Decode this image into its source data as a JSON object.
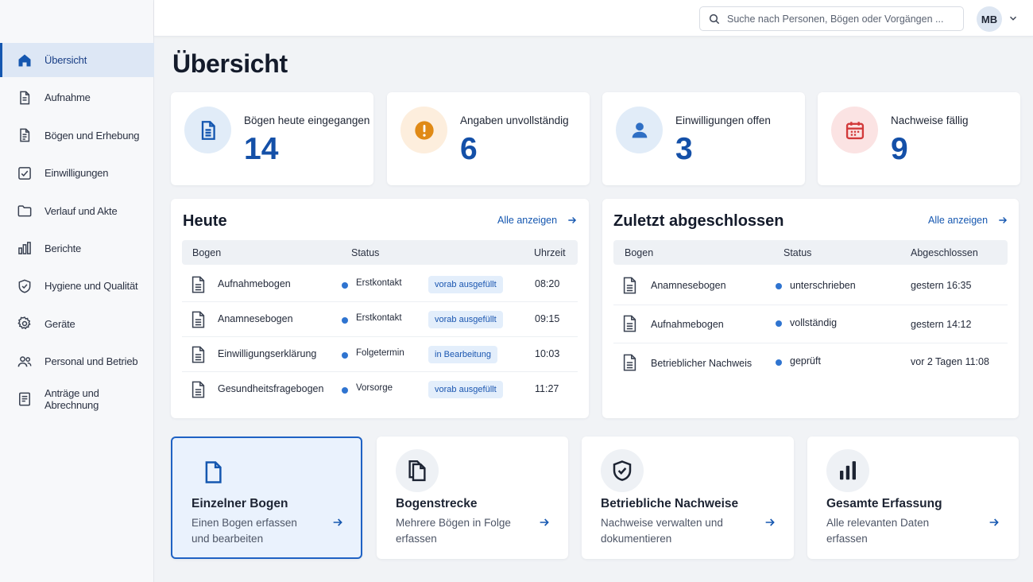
{
  "topbar": {
    "search_placeholder": "Suche nach Personen, Bögen oder Vorgängen ...",
    "avatar_initials": "MB"
  },
  "sidebar": {
    "items": [
      {
        "label": "Übersicht",
        "icon": "home-icon",
        "active": true
      },
      {
        "label": "Aufnahme",
        "icon": "document-icon"
      },
      {
        "label": "Bögen und Erhebung",
        "icon": "form-icon"
      },
      {
        "label": "Einwilligungen",
        "icon": "checkbox-icon"
      },
      {
        "label": "Verlauf und Akte",
        "icon": "folder-icon"
      },
      {
        "label": "Berichte",
        "icon": "bar-chart-icon"
      },
      {
        "label": "Hygiene und Qualität",
        "icon": "shield-icon"
      },
      {
        "label": "Geräte",
        "icon": "gear-icon"
      },
      {
        "label": "Personal und Betrieb",
        "icon": "people-icon"
      },
      {
        "label": "Anträge und Abrechnung",
        "icon": "list-document-icon"
      }
    ]
  },
  "page": {
    "title": "Übersicht"
  },
  "stats": [
    {
      "label": "Bögen heute eingegangen",
      "value": "14",
      "icon": "document-icon",
      "color": "#1557b0",
      "bg": "#e1ecf8"
    },
    {
      "label": "Angaben unvollständig",
      "value": "6",
      "icon": "warning-icon",
      "color": "#e08a16",
      "bg": "#fdeedd"
    },
    {
      "label": "Einwilligungen offen",
      "value": "3",
      "icon": "person-icon",
      "color": "#2f6fc4",
      "bg": "#e1ecf8"
    },
    {
      "label": "Nachweise fällig",
      "value": "9",
      "icon": "calendar-icon",
      "color": "#d2393a",
      "bg": "#fbe3e3"
    }
  ],
  "today": {
    "title": "Heute",
    "show_all": "Alle anzeigen",
    "columns": [
      "Bogen",
      "Status",
      "Uhrzeit"
    ],
    "rows": [
      {
        "bogen": "Aufnahmebogen",
        "status": "Erstkontakt",
        "chip": "vorab ausgefüllt",
        "time": "08:20"
      },
      {
        "bogen": "Anamnesebogen",
        "status": "Erstkontakt",
        "chip": "vorab ausgefüllt",
        "time": "09:15"
      },
      {
        "bogen": "Einwilligungserklärung",
        "status": "Folgetermin",
        "chip": "in Bearbeitung",
        "time": "10:03"
      },
      {
        "bogen": "Gesundheitsfragebogen",
        "status": "Vorsorge",
        "chip": "vorab ausgefüllt",
        "time": "11:27"
      }
    ]
  },
  "recent": {
    "title": "Zuletzt abgeschlossen",
    "show_all": "Alle anzeigen",
    "columns": [
      "Bogen",
      "Status",
      "Abgeschlossen"
    ],
    "rows": [
      {
        "bogen": "Anamnesebogen",
        "status": "unterschrieben",
        "done": "gestern 16:35"
      },
      {
        "bogen": "Aufnahmebogen",
        "status": "vollständig",
        "done": "gestern 14:12"
      },
      {
        "bogen": "Betrieblicher Nachweis",
        "status": "geprüft",
        "done": "vor 2 Tagen 11:08"
      }
    ]
  },
  "actions": [
    {
      "title": "Einzelner Bogen",
      "desc": "Einen Bogen erfassen und bearbeiten",
      "icon": "document-icon",
      "selected": true
    },
    {
      "title": "Bogenstrecke",
      "desc": "Mehrere Bögen in Folge erfassen",
      "icon": "documents-stack-icon"
    },
    {
      "title": "Betriebliche Nachweise",
      "desc": "Nachweise verwalten und dokumentieren",
      "icon": "shield-check-icon"
    },
    {
      "title": "Gesamte Erfassung",
      "desc": "Alle relevanten Daten erfassen",
      "icon": "bar-chart-icon"
    }
  ]
}
